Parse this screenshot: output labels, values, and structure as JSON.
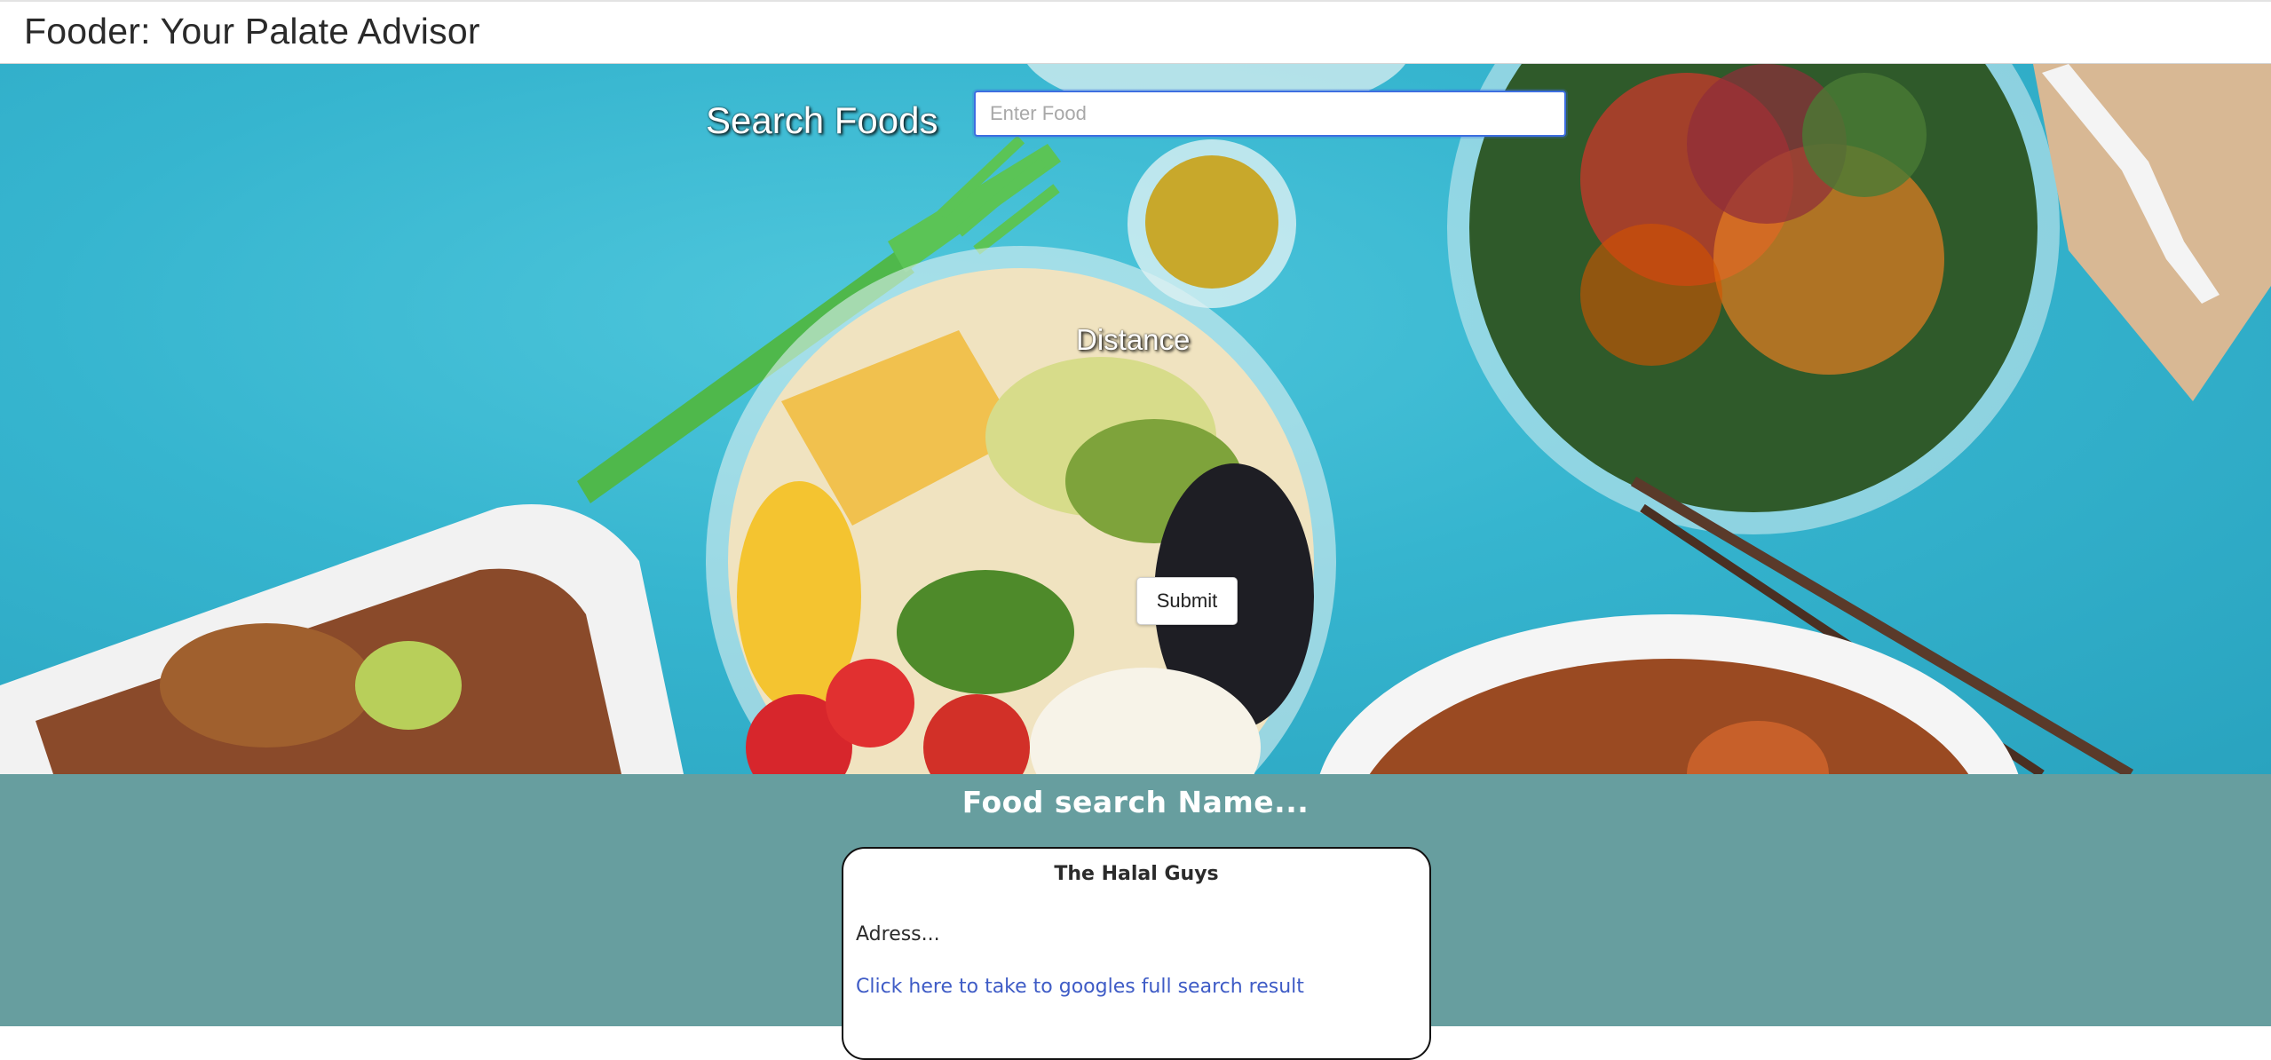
{
  "header": {
    "title": "Fooder: Your Palate Advisor"
  },
  "search": {
    "label": "Search Foods",
    "placeholder": "Enter Food",
    "value": ""
  },
  "distance": {
    "label": "Distance"
  },
  "submit": {
    "label": "Submit"
  },
  "results": {
    "heading": "Food search Name...",
    "cards": [
      {
        "name": "The Halal Guys",
        "address": "Adress...",
        "link_text": "Click here to take to googles full search result"
      }
    ]
  },
  "colors": {
    "hero_background": "#36b5cf",
    "results_background": "#679e9f",
    "link": "#3f5cc6",
    "input_focus_border": "#3d6ee0"
  }
}
